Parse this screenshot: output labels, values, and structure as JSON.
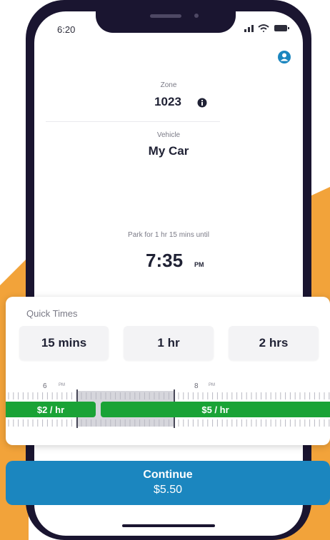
{
  "status": {
    "time": "6:20"
  },
  "zone": {
    "label": "Zone",
    "value": "1023"
  },
  "vehicle": {
    "label": "Vehicle",
    "value": "My Car"
  },
  "parking": {
    "summary": "Park for 1 hr 15 mins until",
    "time": "7:35",
    "ampm": "PM"
  },
  "quick_times": {
    "title": "Quick Times",
    "options": [
      "15 mins",
      "1 hr",
      "2 hrs"
    ]
  },
  "timeline": {
    "hour_labels": [
      {
        "hour": "6",
        "ampm": "PM"
      },
      {
        "hour": "8",
        "ampm": "PM"
      }
    ],
    "rates": [
      "$2 / hr",
      "$5 / hr"
    ]
  },
  "continue": {
    "label": "Continue",
    "price": "$5.50"
  },
  "colors": {
    "accent": "#1b86bf",
    "rate_green": "#1aa336",
    "brand_orange": "#f2a33a",
    "ink": "#1f2134"
  },
  "icons": [
    "signal-icon",
    "wifi-icon",
    "battery-icon",
    "profile-icon",
    "info-icon"
  ]
}
